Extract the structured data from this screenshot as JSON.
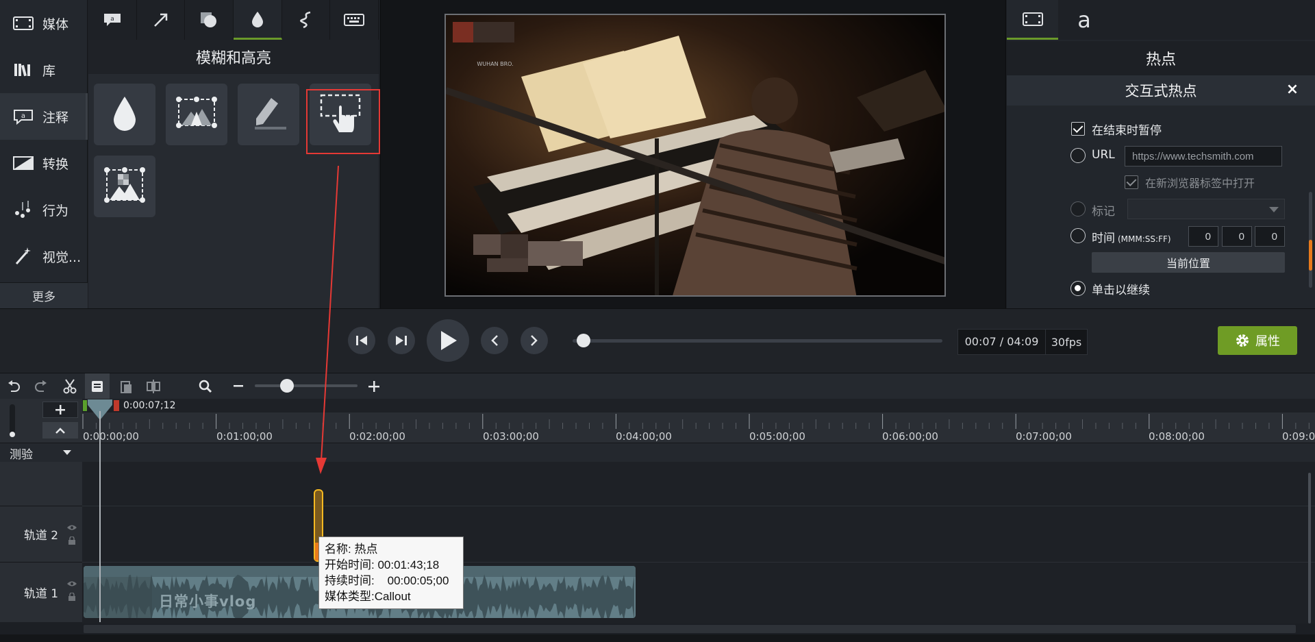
{
  "nav": {
    "items": [
      {
        "label": "媒体",
        "icon": "film-icon"
      },
      {
        "label": "库",
        "icon": "library-icon"
      },
      {
        "label": "注释",
        "icon": "annotation-icon"
      },
      {
        "label": "转换",
        "icon": "transition-icon"
      },
      {
        "label": "行为",
        "icon": "behavior-icon"
      },
      {
        "label": "视觉...",
        "icon": "magic-wand-icon"
      }
    ],
    "more": "更多"
  },
  "annotations": {
    "title": "模糊和高亮",
    "tabs": [
      "callout-icon",
      "arrow-icon",
      "shape-icon",
      "blur-drop-icon",
      "sketch-icon",
      "keyboard-icon"
    ],
    "tools": [
      "blur-icon",
      "spotlight-icon",
      "highlight-icon",
      "interactive-hotspot-icon",
      "pixelate-icon"
    ]
  },
  "preview": {
    "watermark": "WUHAN BRO."
  },
  "properties": {
    "title": "热点",
    "subtitle": "交互式热点",
    "close": "×",
    "pause_at_end": "在结束时暂停",
    "url_label": "URL",
    "url_placeholder": "https://www.techsmith.com",
    "open_new_tab": "在新浏览器标签中打开",
    "marker_label": "标记",
    "time_label": "时间",
    "time_format": "(MMM:SS:FF)",
    "time_values": [
      "0",
      "0",
      "0"
    ],
    "current_position": "当前位置",
    "click_to_continue": "单击以继续"
  },
  "transport": {
    "timecode": "00:07 / 04:09",
    "fps": "30fps",
    "properties_button": "属性",
    "progress": 0.03
  },
  "timeline": {
    "playhead_time": "0:00:07;12",
    "ruler": [
      "0:00:00;00",
      "0:01:00;00",
      "0:02:00;00",
      "0:03:00;00",
      "0:04:00;00",
      "0:05:00;00",
      "0:06:00;00",
      "0:07:00;00",
      "0:08:00;00",
      "0:09:0"
    ],
    "quiz_label": "测验",
    "tracks": [
      "轨道 2",
      "轨道 1"
    ],
    "clip_label": "日常小事vlog",
    "tooltip": {
      "name": "名称: 热点",
      "start": "开始时间: 00:01:43;18",
      "duration": "持续时间:    00:00:05;00",
      "media_type": "媒体类型:Callout"
    }
  }
}
